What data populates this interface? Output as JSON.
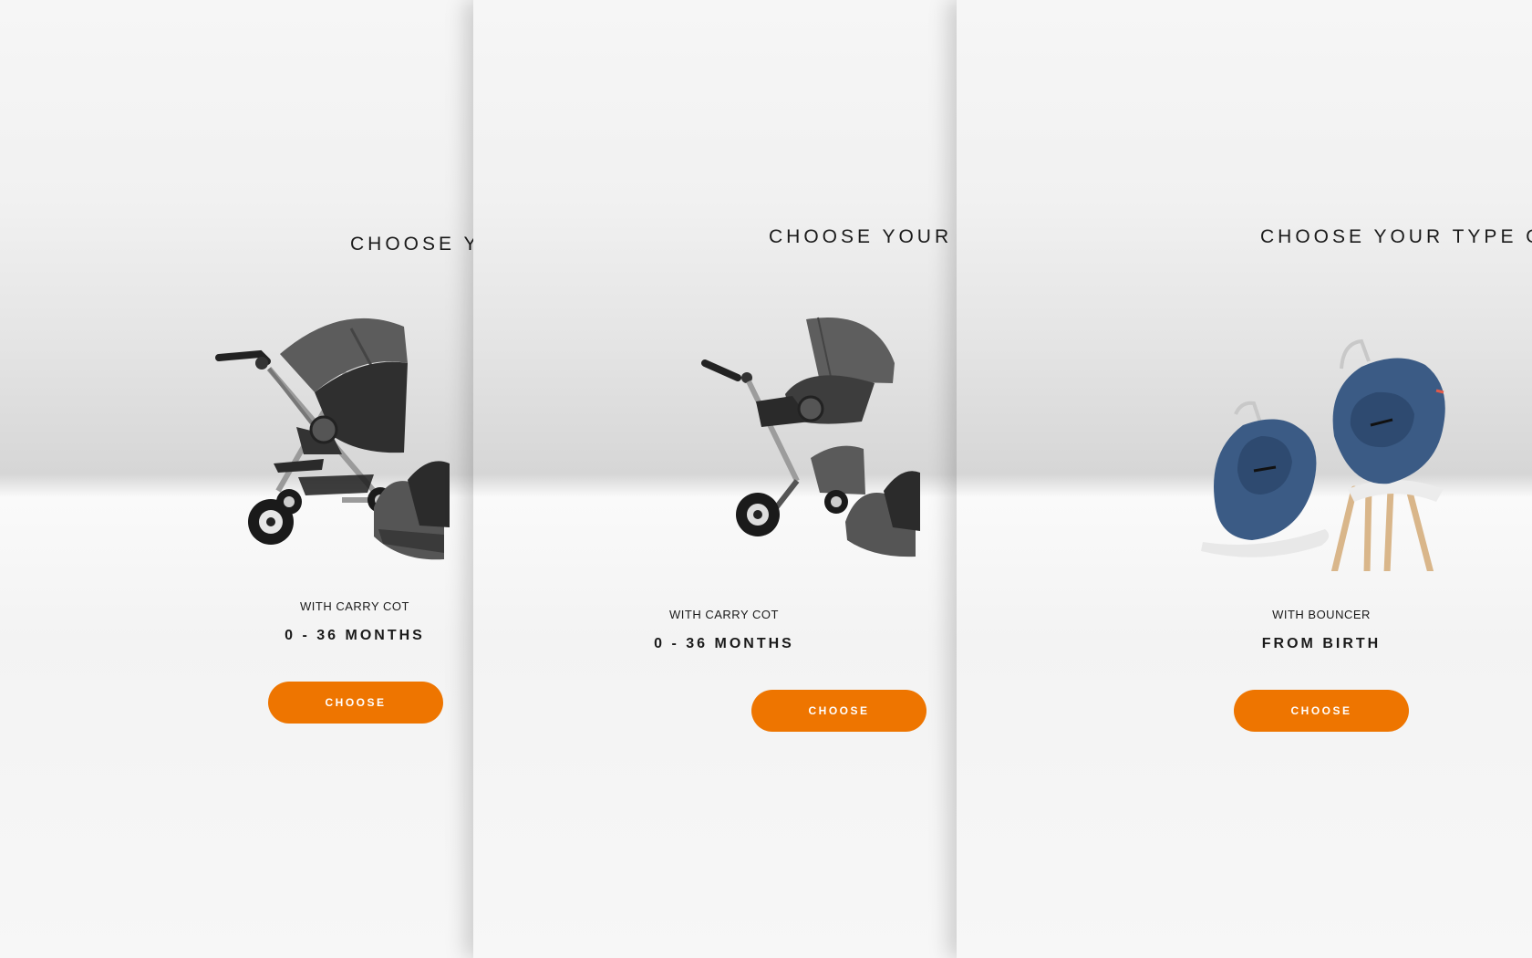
{
  "panels": [
    {
      "heading": "CHOOSE YOUR TYPE OF",
      "image": "stroller-scoot-icon",
      "subtitle": "WITH CARRY COT",
      "age": "0 - 36 MONTHS",
      "button": "CHOOSE"
    },
    {
      "heading": "CHOOSE YOUR TYPE OF",
      "image": "stroller-xplory-icon",
      "subtitle": "WITH CARRY COT",
      "age": "0 - 36 MONTHS",
      "button": "CHOOSE"
    },
    {
      "heading": "CHOOSE YOUR TYPE OF",
      "image": "bouncer-chair-icon",
      "subtitle": "WITH BOUNCER",
      "age": "FROM BIRTH",
      "button": "CHOOSE"
    }
  ],
  "colors": {
    "accent": "#ee7500",
    "text": "#1a1a1a",
    "stroller_fabric": "#5a5a5a",
    "bouncer_fabric": "#3b5b85"
  }
}
